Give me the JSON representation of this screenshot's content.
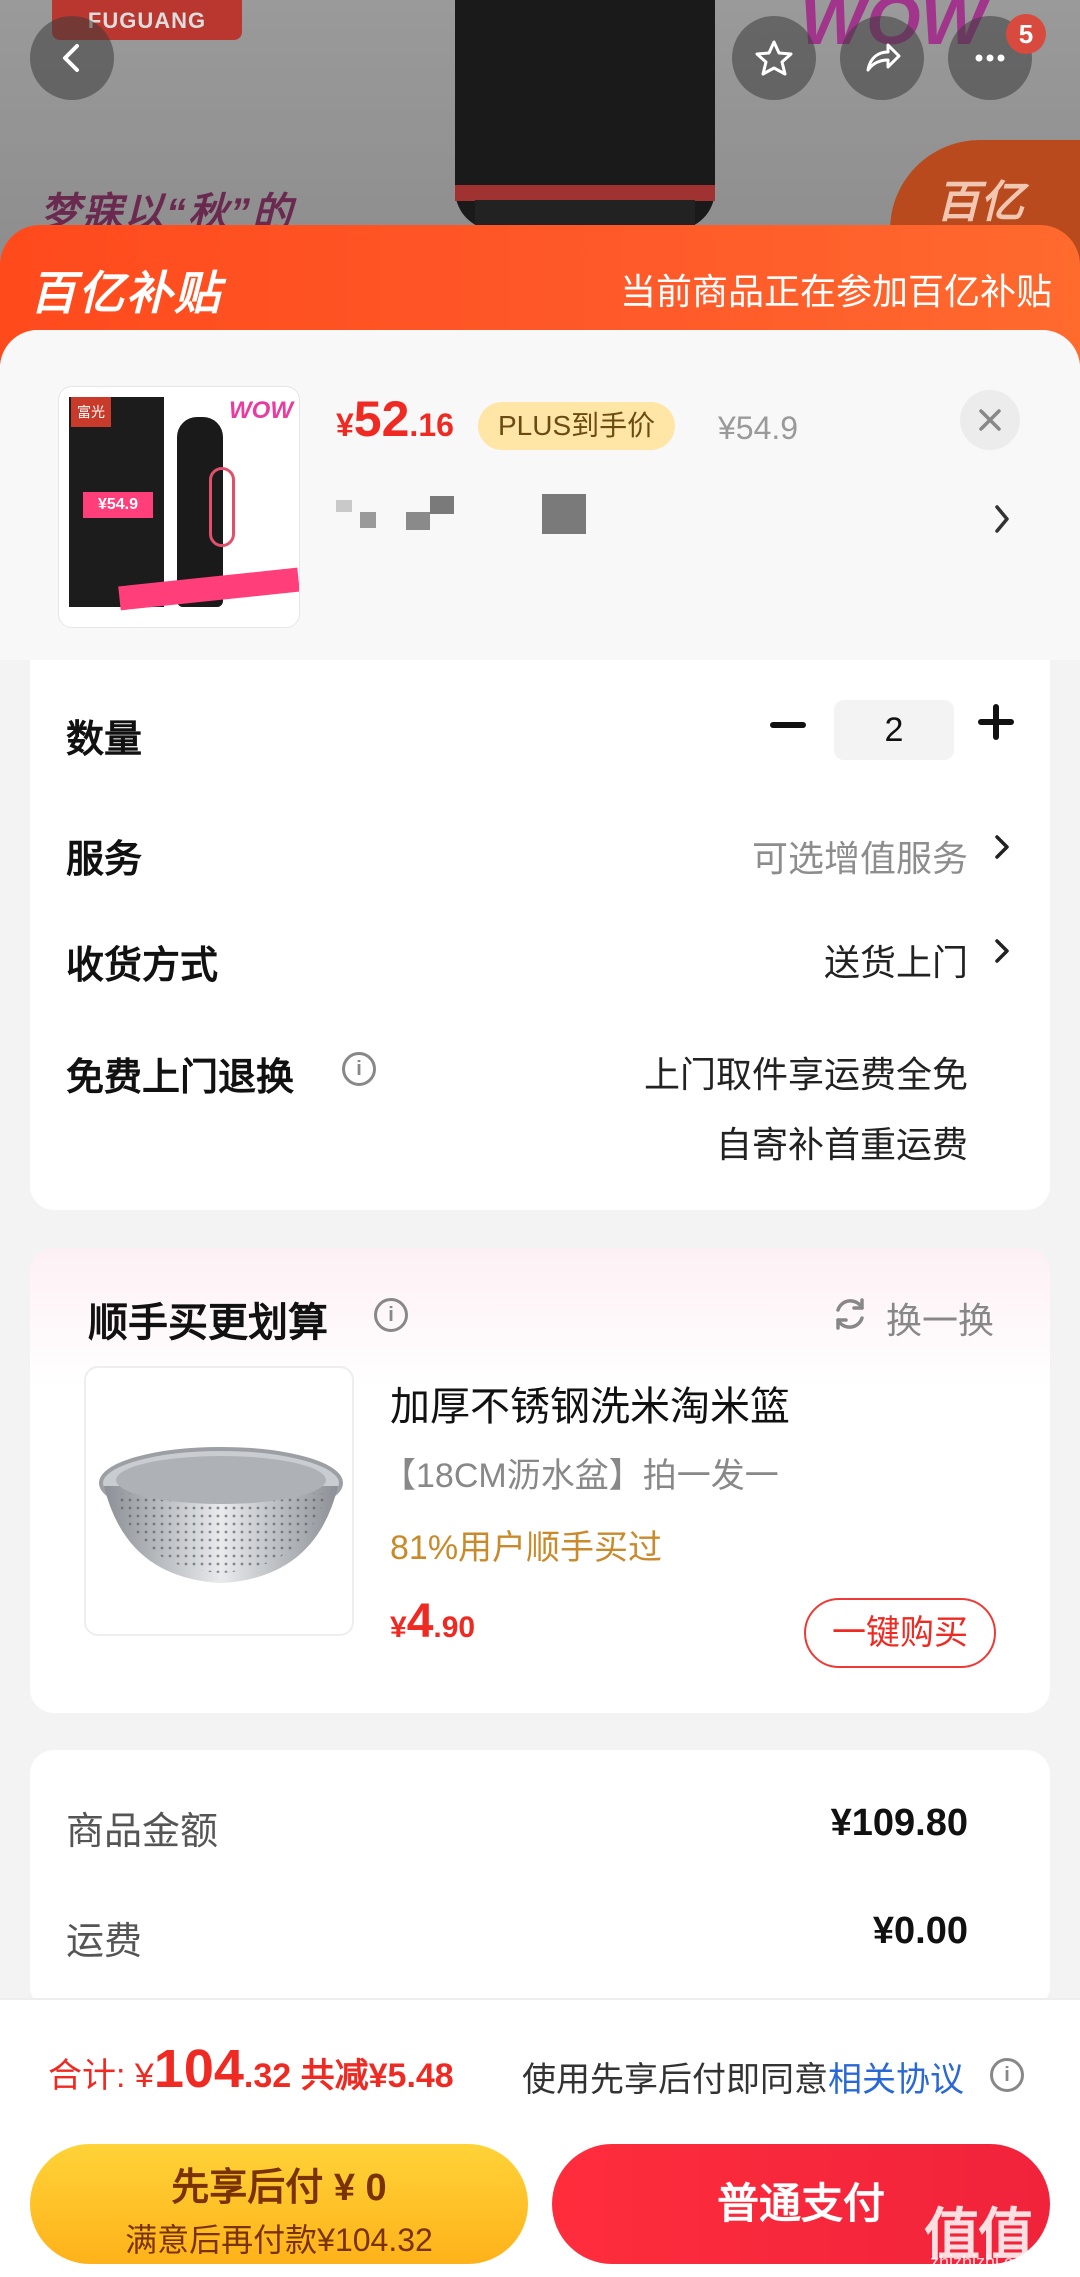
{
  "banner": {
    "brand": "FUGUANG",
    "slogan": "梦寐以“秋”的",
    "wow": "WOW",
    "corner_badge": "百亿",
    "cart_count": "5",
    "icons": [
      "back-arrow-icon",
      "star-icon",
      "share-icon",
      "more-icon"
    ]
  },
  "subsidy": {
    "logo": "百亿补贴",
    "note": "当前商品正在参加百亿补贴"
  },
  "product": {
    "thumb_tag": "富光",
    "thumb_price": "¥54.9",
    "thumb_wow": "WOW",
    "price_symbol": "¥",
    "price_int": "52",
    "price_dec": ".16",
    "plus_tag": "PLUS到手价",
    "original_price": "¥54.9"
  },
  "options": {
    "quantity_label": "数量",
    "quantity_value": "2",
    "service_label": "服务",
    "service_value": "可选增值服务",
    "delivery_label": "收货方式",
    "delivery_value": "送货上门",
    "return_label": "免费上门退换",
    "return_line1": "上门取件享运费全免",
    "return_line2": "自寄补首重运费"
  },
  "recommend": {
    "title": "顺手买更划算",
    "refresh": "换一换",
    "name": "加厚不锈钢洗米淘米篮",
    "spec": "【18CM沥水盆】拍一发一",
    "stat": "81%用户顺手买过",
    "price_symbol": "¥",
    "price_int": "4",
    "price_dec": ".90",
    "buy_label": "一键购买"
  },
  "amount": {
    "goods_label": "商品金额",
    "goods_value": "¥109.80",
    "shipping_label": "运费",
    "shipping_value": "¥0.00"
  },
  "total": {
    "label": "合计: ¥",
    "int": "104",
    "dec": ".32",
    "cut": " 共减¥5.48",
    "agree_text": "使用先享后付即同意",
    "agree_link": "相关协议"
  },
  "pay": {
    "later_line1": "先享后付 ¥ 0",
    "later_line2": "满意后再付款¥104.32",
    "normal": "普通支付"
  },
  "watermark": {
    "text": "值值值",
    "sub": "zhizhizhi.com"
  },
  "colors": {
    "accent_red": "#ee2a22",
    "subsidy_orange": "#ff4a1c",
    "pay_yellow": "#ffc22a",
    "link_blue": "#2a68d6"
  }
}
